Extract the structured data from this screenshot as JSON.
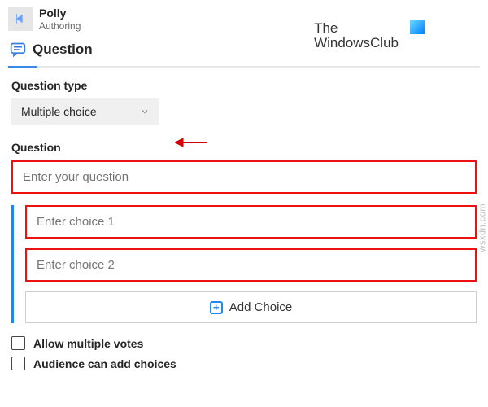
{
  "app": {
    "title": "Polly",
    "subtitle": "Authoring"
  },
  "logo": {
    "line1": "The",
    "line2": "WindowsClub"
  },
  "section": {
    "title": "Question"
  },
  "question_type": {
    "label": "Question type",
    "value": "Multiple choice"
  },
  "question": {
    "label": "Question",
    "placeholder": "Enter your question"
  },
  "choices": [
    {
      "placeholder": "Enter choice 1"
    },
    {
      "placeholder": "Enter choice 2"
    }
  ],
  "add_choice": {
    "label": "Add Choice"
  },
  "options": {
    "allow_multiple_votes": "Allow multiple votes",
    "audience_can_add": "Audience can add choices"
  },
  "watermark": "wsxdn.com"
}
